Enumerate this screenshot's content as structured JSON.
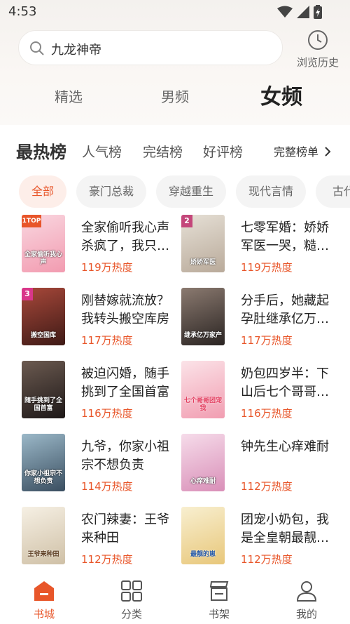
{
  "status_bar": {
    "time": "4:53"
  },
  "search": {
    "query": "九龙神帝"
  },
  "history": {
    "label": "浏览历史"
  },
  "channel_tabs": [
    {
      "label": "精选",
      "active": false
    },
    {
      "label": "男频",
      "active": false
    },
    {
      "label": "女频",
      "active": true
    }
  ],
  "rank_tabs": {
    "main": "最热榜",
    "items": [
      "人气榜",
      "完结榜",
      "好评榜"
    ],
    "full_list": "完整榜单"
  },
  "filters": [
    "全部",
    "豪门总裁",
    "穿越重生",
    "现代言情",
    "古代"
  ],
  "books": [
    {
      "title": "全家偷听我心声杀疯了，我只管吃奶",
      "heat": "119万热度",
      "cover_color": "#f6c6d2",
      "cover_label": "全家偷听我心声"
    },
    {
      "title": "七零军婚：娇娇军医一哭，糙汉宠上天",
      "heat": "119万热度",
      "cover_color": "#d9d2c8",
      "cover_label": "娇娇军医"
    },
    {
      "title": "刚替嫁就流放？我转头搬空库房",
      "heat": "117万热度",
      "cover_color": "#7a2e24",
      "cover_label": "搬空国库"
    },
    {
      "title": "分手后，她藏起孕肚继承亿万家产",
      "heat": "117万热度",
      "cover_color": "#4a3e3a",
      "cover_label": "继承亿万家产"
    },
    {
      "title": "被迫闪婚，随手挑到了全国首富",
      "heat": "116万热度",
      "cover_color": "#3a3030",
      "cover_label": "随手挑到了全国首富"
    },
    {
      "title": "奶包四岁半：下山后七个哥哥团宠我",
      "heat": "116万热度",
      "cover_color": "#f7d3da",
      "cover_label": "七个哥哥团宠我"
    },
    {
      "title": "九爷，你家小祖宗不想负责",
      "heat": "114万热度",
      "cover_color": "#5a7a8c",
      "cover_label": "你家小祖宗不想负责"
    },
    {
      "title": "钟先生心痒难耐",
      "heat": "112万热度",
      "cover_color": "#e9c2d8",
      "cover_label": "心痒难耐"
    },
    {
      "title": "农门辣妻：王爷来种田",
      "heat": "112万热度",
      "cover_color": "#efe7d8",
      "cover_label": "王爷来种田"
    },
    {
      "title": "团宠小奶包，我是全皇朝最靓的崽",
      "heat": "112万热度",
      "cover_color": "#f3e9c6",
      "cover_label": "最靓的崽"
    }
  ],
  "bottom_nav": [
    {
      "label": "书城",
      "icon": "store-icon",
      "active": true
    },
    {
      "label": "分类",
      "icon": "grid-icon",
      "active": false
    },
    {
      "label": "书架",
      "icon": "bookshelf-icon",
      "active": false
    },
    {
      "label": "我的",
      "icon": "user-icon",
      "active": false
    }
  ],
  "colors": {
    "accent": "#e8562a",
    "chip_active_bg": "#fdeee9"
  }
}
